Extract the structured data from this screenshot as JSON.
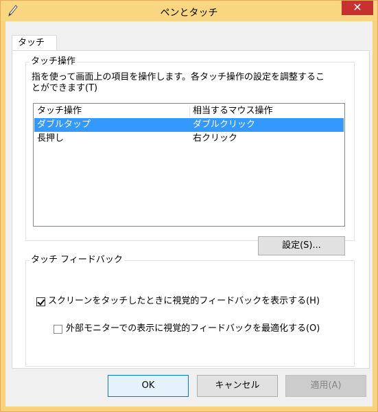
{
  "window": {
    "title": "ペンとタッチ",
    "close_glyph": "✕"
  },
  "tabs": [
    {
      "label": "タッチ",
      "selected": true
    }
  ],
  "touch_operations": {
    "group_label": "タッチ操作",
    "description_line1": "指を使って画面上の項目を操作します。各タッチ操作の設定を調整するこ",
    "description_line2": "とができます(T)",
    "columns": [
      "タッチ操作",
      "相当するマウス操作"
    ],
    "rows": [
      {
        "action": "ダブルタップ",
        "mouse": "ダブルクリック",
        "selected": true
      },
      {
        "action": "長押し",
        "mouse": "右クリック",
        "selected": false
      }
    ],
    "settings_button": "設定(S)..."
  },
  "touch_feedback": {
    "group_label": "タッチ フィードバック",
    "show_feedback": {
      "label": "スクリーンをタッチしたときに視覚的フィードバックを表示する(H)",
      "checked": true
    },
    "optimize_external": {
      "label": "外部モニターでの表示に視覚的フィードバックを最適化する(O)",
      "checked": false
    }
  },
  "footer": {
    "ok": "OK",
    "cancel": "キャンセル",
    "apply": "適用(A)"
  },
  "colors": {
    "title_bar": "#f9d780",
    "close_button": "#c7312f",
    "selection": "#3399ff"
  }
}
